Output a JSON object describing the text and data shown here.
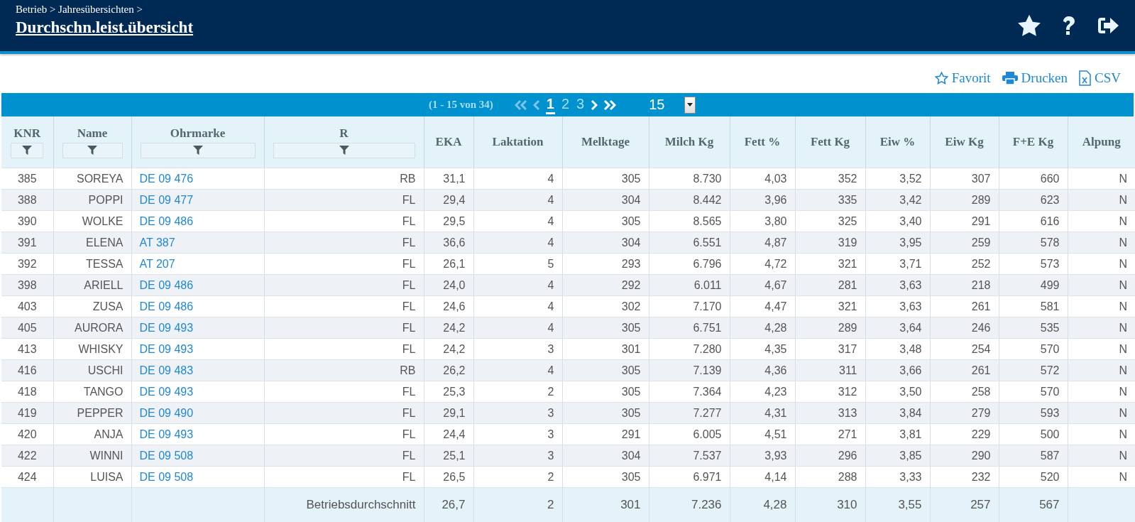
{
  "header": {
    "breadcrumb": "Betrieb > Jahresübersichten >",
    "title": "Durchschn.leist.übersicht"
  },
  "toolbar": [
    "Favorit",
    "Drucken",
    "CSV"
  ],
  "pager": {
    "range": "(1 - 15 von 34)",
    "pages": [
      {
        "label": "1",
        "selected": true
      },
      {
        "label": "2",
        "selected": false
      },
      {
        "label": "3",
        "selected": false
      }
    ],
    "page_size": "15"
  },
  "table": {
    "columns": [
      {
        "label": "KNR",
        "filter": true
      },
      {
        "label": "Name",
        "filter": true
      },
      {
        "label": "Ohrmarke",
        "filter": true
      },
      {
        "label": "R",
        "filter": true
      },
      {
        "label": "EKA",
        "filter": false
      },
      {
        "label": "Laktation",
        "filter": false
      },
      {
        "label": "Melktage",
        "filter": false
      },
      {
        "label": "Milch Kg",
        "filter": false
      },
      {
        "label": "Fett %",
        "filter": false
      },
      {
        "label": "Fett Kg",
        "filter": false
      },
      {
        "label": "Eiw %",
        "filter": false
      },
      {
        "label": "Eiw Kg",
        "filter": false
      },
      {
        "label": "F+E Kg",
        "filter": false
      },
      {
        "label": "Alpung",
        "filter": false
      }
    ],
    "rows": [
      [
        "385",
        "SOREYA",
        "DE 09 476",
        "RB",
        "31,1",
        "4",
        "305",
        "8.730",
        "4,03",
        "352",
        "3,52",
        "307",
        "660",
        "N"
      ],
      [
        "388",
        "POPPI",
        "DE 09 477",
        "FL",
        "29,4",
        "4",
        "304",
        "8.442",
        "3,96",
        "335",
        "3,42",
        "289",
        "623",
        "N"
      ],
      [
        "390",
        "WOLKE",
        "DE 09 486",
        "FL",
        "29,5",
        "4",
        "305",
        "8.565",
        "3,80",
        "325",
        "3,40",
        "291",
        "616",
        "N"
      ],
      [
        "391",
        "ELENA",
        "AT 387",
        "FL",
        "36,6",
        "4",
        "304",
        "6.551",
        "4,87",
        "319",
        "3,95",
        "259",
        "578",
        "N"
      ],
      [
        "392",
        "TESSA",
        "AT 207",
        "FL",
        "26,1",
        "5",
        "293",
        "6.796",
        "4,72",
        "321",
        "3,71",
        "252",
        "573",
        "N"
      ],
      [
        "398",
        "ARIELL",
        "DE 09 486",
        "FL",
        "24,0",
        "4",
        "292",
        "6.011",
        "4,67",
        "281",
        "3,63",
        "218",
        "499",
        "N"
      ],
      [
        "403",
        "ZUSA",
        "DE 09 486",
        "FL",
        "24,6",
        "4",
        "302",
        "7.170",
        "4,47",
        "321",
        "3,63",
        "261",
        "581",
        "N"
      ],
      [
        "405",
        "AURORA",
        "DE 09 493",
        "FL",
        "24,2",
        "4",
        "305",
        "6.751",
        "4,28",
        "289",
        "3,64",
        "246",
        "535",
        "N"
      ],
      [
        "413",
        "WHISKY",
        "DE 09 493",
        "FL",
        "24,2",
        "3",
        "301",
        "7.280",
        "4,35",
        "317",
        "3,48",
        "254",
        "570",
        "N"
      ],
      [
        "416",
        "USCHI",
        "DE 09 483",
        "RB",
        "26,2",
        "4",
        "305",
        "7.139",
        "4,36",
        "311",
        "3,66",
        "261",
        "572",
        "N"
      ],
      [
        "418",
        "TANGO",
        "DE 09 493",
        "FL",
        "25,3",
        "2",
        "305",
        "7.364",
        "4,23",
        "312",
        "3,50",
        "258",
        "570",
        "N"
      ],
      [
        "419",
        "PEPPER",
        "DE 09 490",
        "FL",
        "29,1",
        "3",
        "305",
        "7.277",
        "4,31",
        "313",
        "3,84",
        "279",
        "593",
        "N"
      ],
      [
        "420",
        "ANJA",
        "DE 09 493",
        "FL",
        "24,4",
        "3",
        "291",
        "6.005",
        "4,51",
        "271",
        "3,81",
        "229",
        "500",
        "N"
      ],
      [
        "422",
        "WINNI",
        "DE 09 508",
        "FL",
        "25,1",
        "3",
        "304",
        "7.537",
        "3,93",
        "296",
        "3,85",
        "290",
        "587",
        "N"
      ],
      [
        "424",
        "LUISA",
        "DE 09 508",
        "FL",
        "26,5",
        "2",
        "305",
        "6.971",
        "4,14",
        "288",
        "3,33",
        "232",
        "520",
        "N"
      ]
    ],
    "footer": {
      "label": "Betriebsdurchschnitt",
      "values": [
        "26,7",
        "2",
        "301",
        "7.236",
        "4,28",
        "310",
        "3,55",
        "257",
        "567"
      ]
    }
  }
}
